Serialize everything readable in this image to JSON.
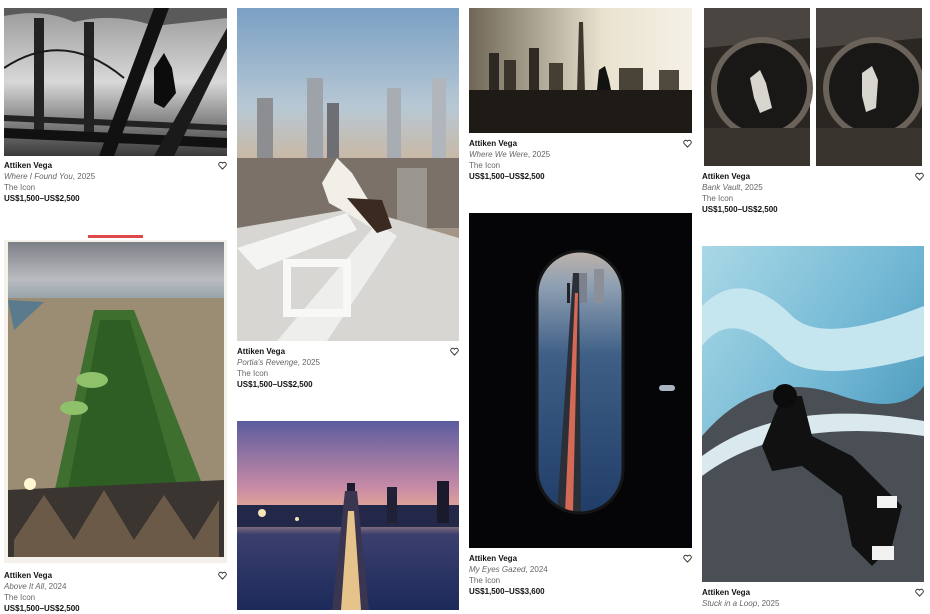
{
  "accent_color": "#e04848",
  "icons": {
    "favorite": "heart-outline-icon"
  },
  "artworks": [
    {
      "id": "a1",
      "artist": "Attiken Vega",
      "title": "Where I Found You",
      "year": ", 2025",
      "seller": "The Icon",
      "price": "US$1,500–US$2,500"
    },
    {
      "id": "a2",
      "artist": "Attiken Vega",
      "title": "Portia's Revenge",
      "year": ", 2025",
      "seller": "The Icon",
      "price": "US$1,500–US$2,500"
    },
    {
      "id": "a3",
      "artist": "Attiken Vega",
      "title": "Where We Were",
      "year": ", 2025",
      "seller": "The Icon",
      "price": "US$1,500–US$2,500"
    },
    {
      "id": "a4",
      "artist": "Attiken Vega",
      "title": "Bank Vault",
      "year": ", 2025",
      "seller": "The Icon",
      "price": "US$1,500–US$2,500"
    },
    {
      "id": "a5",
      "artist": "Attiken Vega",
      "title": "Above It All",
      "year": ", 2024",
      "seller": "The Icon",
      "price": "US$1,500–US$2,500"
    },
    {
      "id": "a6",
      "artist": "Attiken Vega",
      "title": "My Eyes Gazed",
      "year": ", 2024",
      "seller": "The Icon",
      "price": "US$1,500–US$3,600"
    },
    {
      "id": "a7",
      "artist": "Attiken Vega",
      "title": "Stuck in a Loop",
      "year": ", 2025"
    }
  ]
}
